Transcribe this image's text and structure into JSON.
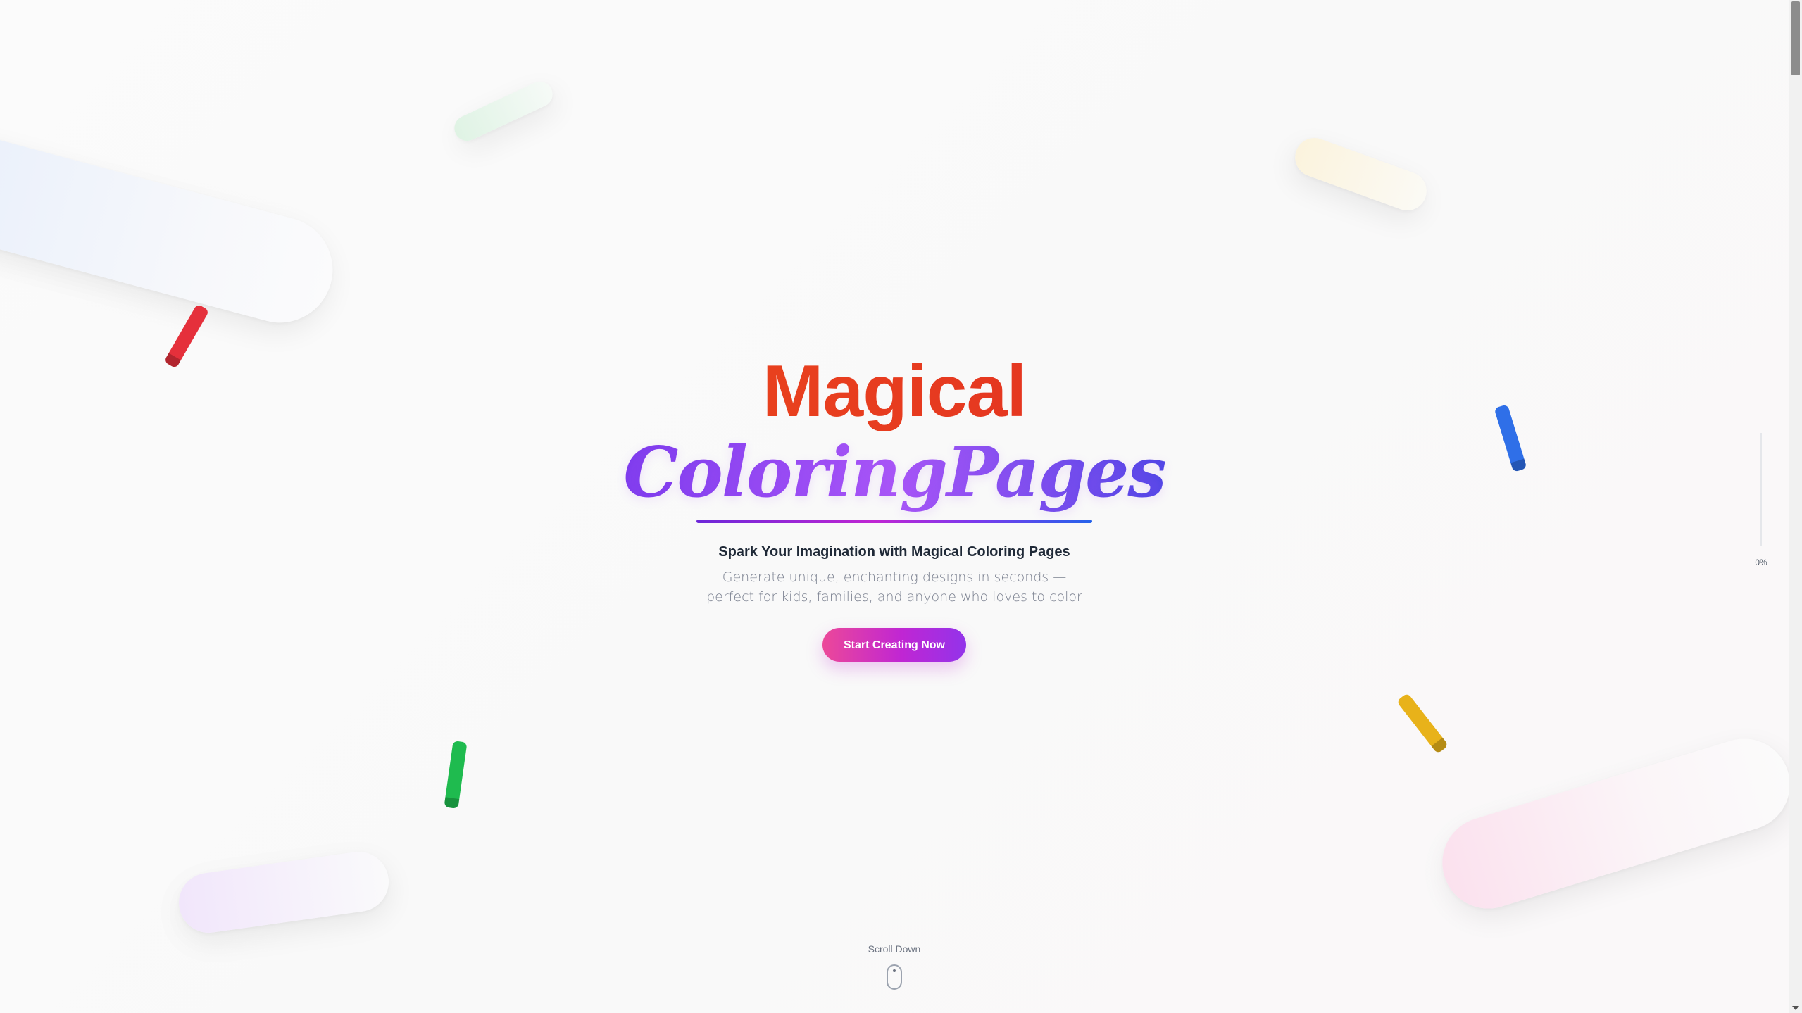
{
  "hero": {
    "title_line1": "Magical",
    "title_line2": "ColoringPages",
    "tagline": "Spark Your Imagination with Magical Coloring Pages",
    "description": "Generate unique, enchanting designs in seconds — perfect for kids, families, and anyone who loves to color",
    "cta_label": "Start Creating Now"
  },
  "scroll_indicator": {
    "label": "Scroll Down",
    "icon": "mouse-icon"
  },
  "progress": {
    "label": "0%",
    "value": 0
  },
  "decorations": {
    "crayons": [
      {
        "name": "red-crayon",
        "color": "#e5303b"
      },
      {
        "name": "blue-crayon",
        "color": "#2f6fe8"
      },
      {
        "name": "green-crayon",
        "color": "#1fbb4f"
      },
      {
        "name": "yellow-crayon",
        "color": "#e8b21a"
      }
    ]
  },
  "colors": {
    "title_line1_gradient": [
      "#ef5b1b",
      "#d81b2b"
    ],
    "title_line2_gradient": [
      "#7c3aed",
      "#a855f7",
      "#4f46e5"
    ],
    "cta_gradient": [
      "#ec4899",
      "#c026d3",
      "#9333ea"
    ],
    "tagline": "#1f2937",
    "description": "#7b8190"
  }
}
